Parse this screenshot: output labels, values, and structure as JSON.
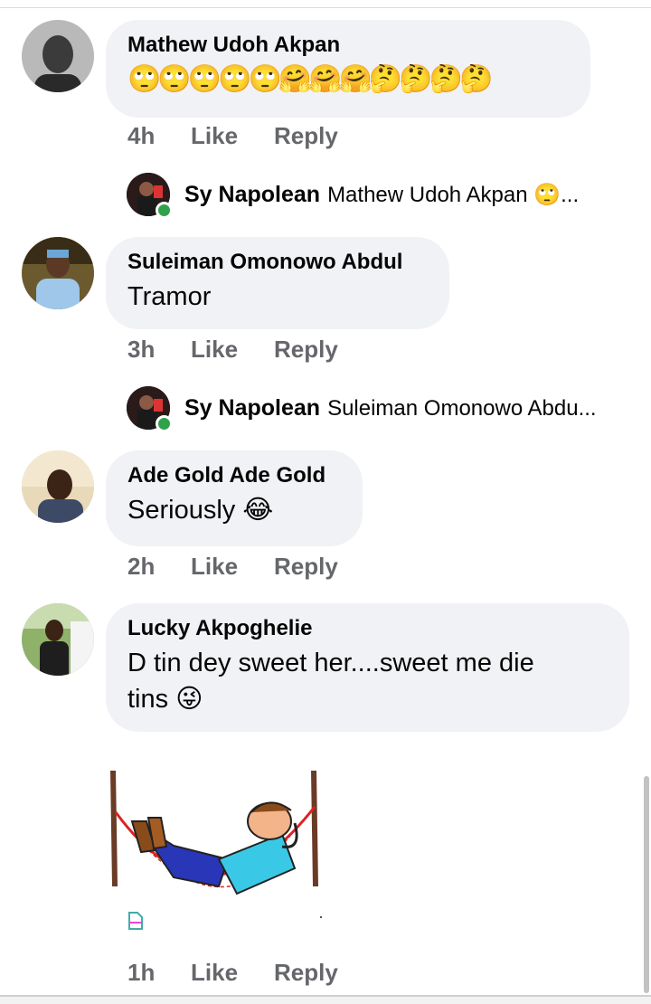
{
  "comments": [
    {
      "author": "Mathew Udoh Akpan",
      "emoji_line": [
        "🙄",
        "🙄",
        "🙄",
        "🙄",
        "🙄",
        "🤗",
        "🤗",
        "🤗",
        "🤔",
        "🤔",
        "🤔",
        "🤔"
      ],
      "time": "4h",
      "like": "Like",
      "reply": "Reply"
    },
    {
      "author": "Suleiman Omonowo Abdul",
      "text": "Tramor",
      "time": "3h",
      "like": "Like",
      "reply": "Reply"
    },
    {
      "author": "Ade Gold Ade Gold",
      "text": "Seriously",
      "emoji": "😂",
      "time": "2h",
      "like": "Like",
      "reply": "Reply"
    },
    {
      "author": "Lucky Akpoghelie",
      "text_line1": "D tin dey sweet her....sweet me die",
      "text_line2": "tins",
      "emoji": "😜",
      "time": "1h",
      "like": "Like",
      "reply": "Reply"
    }
  ],
  "replies": [
    {
      "author": "Sy Napolean",
      "preview": "Mathew Udoh Akpan",
      "emoji": "🙄",
      "ellipsis": "..."
    },
    {
      "author": "Sy Napolean",
      "preview": "Suleiman Omonowo Abdu..."
    }
  ],
  "sticker": {
    "icon": "hammock-sticker-icon"
  },
  "colors": {
    "bubble": "#f0f2f5",
    "meta": "#65676b",
    "online": "#31a24c"
  }
}
